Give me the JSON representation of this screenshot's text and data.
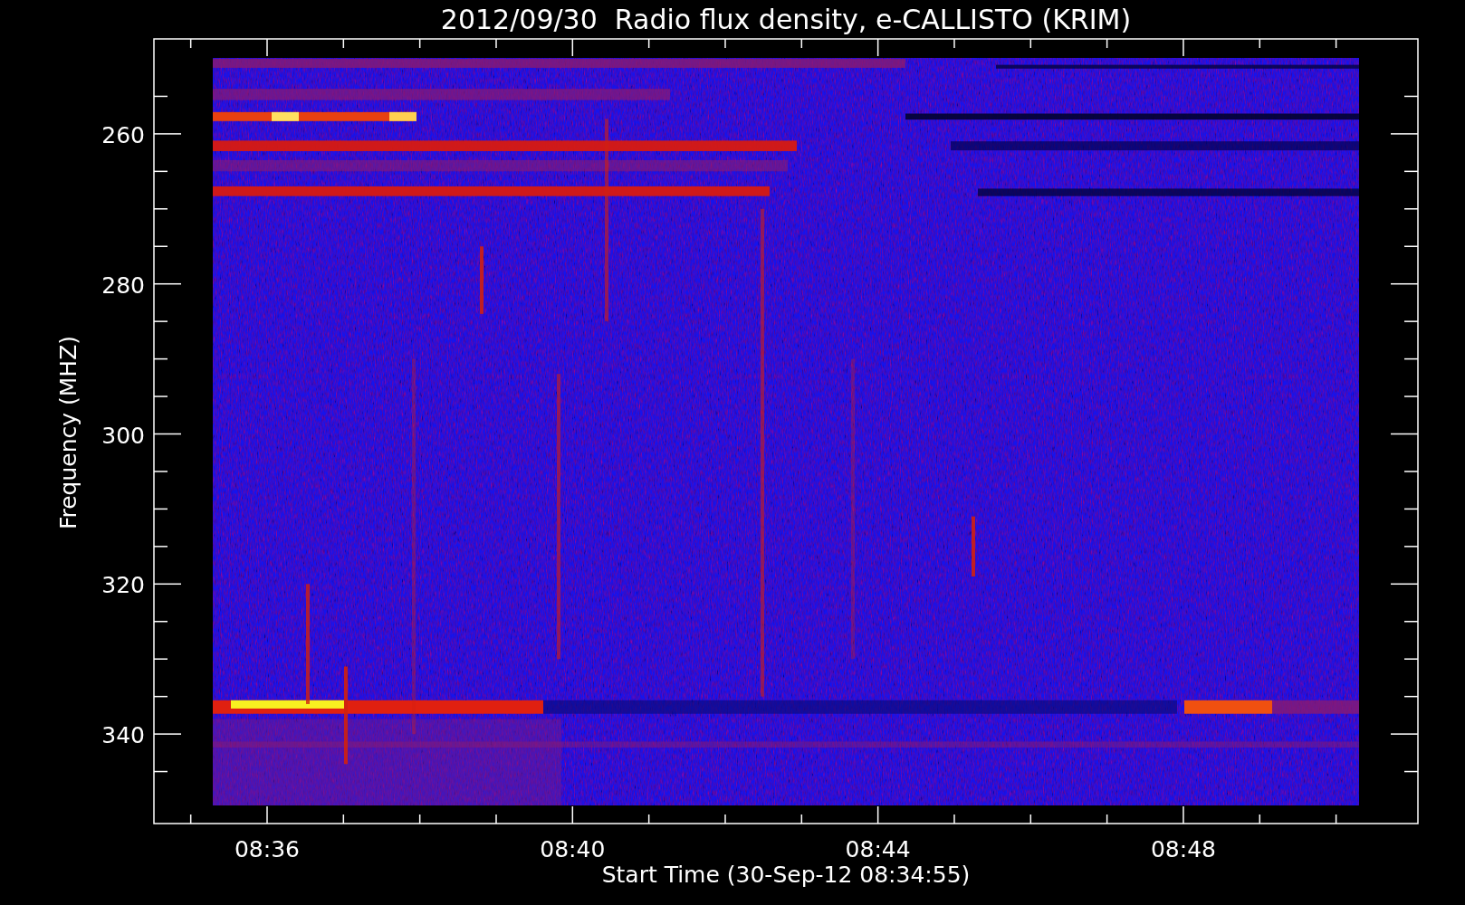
{
  "chart": {
    "title": "2012/09/30  Radio flux density, e-CALLISTO (KRIM)",
    "ylabel": "Frequency (MHZ)",
    "xlabel": "Start Time (30-Sep-12 08:34:55)",
    "yticks": [
      "260",
      "280",
      "300",
      "320",
      "340"
    ],
    "xticks": [
      "08:36",
      "08:40",
      "08:44",
      "08:48"
    ]
  }
}
